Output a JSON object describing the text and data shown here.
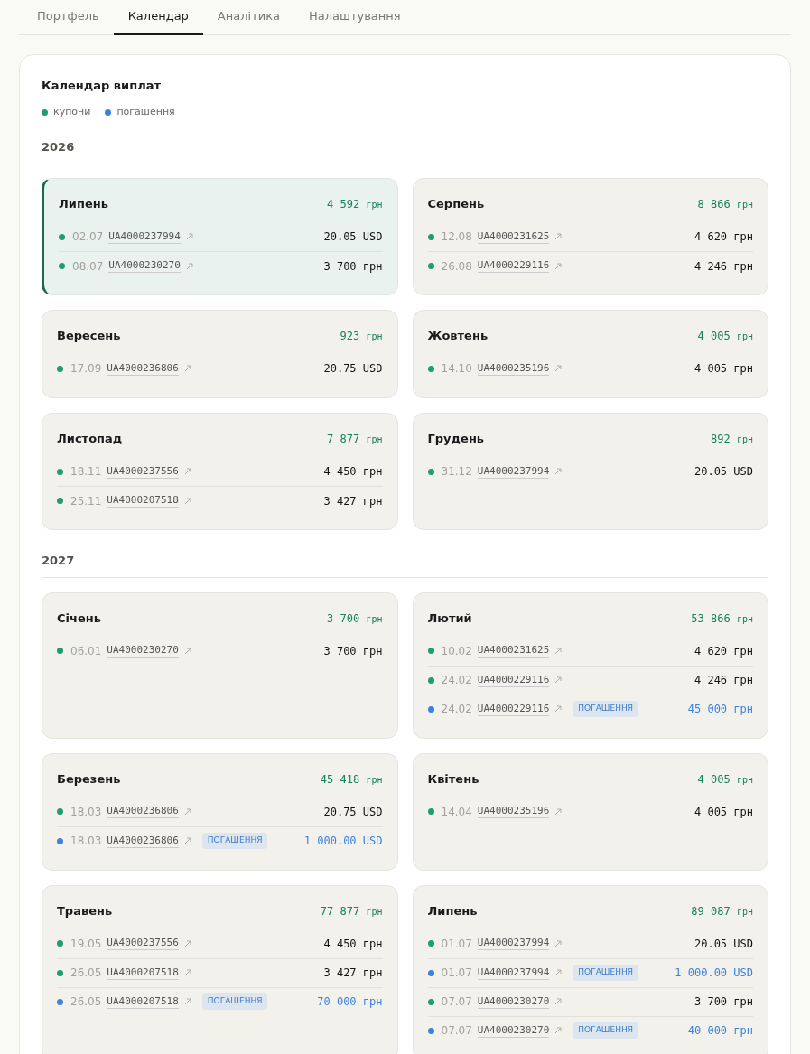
{
  "tabs": [
    {
      "label": "Портфель",
      "selected": false
    },
    {
      "label": "Календар",
      "selected": true
    },
    {
      "label": "Аналітика",
      "selected": false
    },
    {
      "label": "Налаштування",
      "selected": false
    }
  ],
  "panel": {
    "title": "Календар виплат",
    "legend": [
      {
        "label": "купони",
        "color": "#1f9d6e"
      },
      {
        "label": "погашення",
        "color": "#3b82e0"
      }
    ],
    "years": [
      {
        "year": "2026",
        "months": [
          {
            "name": "Липень",
            "total": "4 592",
            "unit": "грн",
            "current": true,
            "payments": [
              {
                "kind": "coupon",
                "date": "02.07",
                "isin": "UA4000237994",
                "amount": "20.05 USD"
              },
              {
                "kind": "coupon",
                "date": "08.07",
                "isin": "UA4000230270",
                "amount": "3 700 грн"
              }
            ]
          },
          {
            "name": "Серпень",
            "total": "8 866",
            "unit": "грн",
            "current": false,
            "payments": [
              {
                "kind": "coupon",
                "date": "12.08",
                "isin": "UA4000231625",
                "amount": "4 620 грн"
              },
              {
                "kind": "coupon",
                "date": "26.08",
                "isin": "UA4000229116",
                "amount": "4 246 грн"
              }
            ]
          },
          {
            "name": "Вересень",
            "total": "923",
            "unit": "грн",
            "current": false,
            "payments": [
              {
                "kind": "coupon",
                "date": "17.09",
                "isin": "UA4000236806",
                "amount": "20.75 USD"
              }
            ]
          },
          {
            "name": "Жовтень",
            "total": "4 005",
            "unit": "грн",
            "current": false,
            "payments": [
              {
                "kind": "coupon",
                "date": "14.10",
                "isin": "UA4000235196",
                "amount": "4 005 грн"
              }
            ]
          },
          {
            "name": "Листопад",
            "total": "7 877",
            "unit": "грн",
            "current": false,
            "payments": [
              {
                "kind": "coupon",
                "date": "18.11",
                "isin": "UA4000237556",
                "amount": "4 450 грн"
              },
              {
                "kind": "coupon",
                "date": "25.11",
                "isin": "UA4000207518",
                "amount": "3 427 грн"
              }
            ]
          },
          {
            "name": "Грудень",
            "total": "892",
            "unit": "грн",
            "current": false,
            "payments": [
              {
                "kind": "coupon",
                "date": "31.12",
                "isin": "UA4000237994",
                "amount": "20.05 USD"
              }
            ]
          }
        ]
      },
      {
        "year": "2027",
        "months": [
          {
            "name": "Січень",
            "total": "3 700",
            "unit": "грн",
            "current": false,
            "payments": [
              {
                "kind": "coupon",
                "date": "06.01",
                "isin": "UA4000230270",
                "amount": "3 700 грн"
              }
            ]
          },
          {
            "name": "Лютий",
            "total": "53 866",
            "unit": "грн",
            "current": false,
            "payments": [
              {
                "kind": "coupon",
                "date": "10.02",
                "isin": "UA4000231625",
                "amount": "4 620 грн"
              },
              {
                "kind": "coupon",
                "date": "24.02",
                "isin": "UA4000229116",
                "amount": "4 246 грн"
              },
              {
                "kind": "redemption",
                "date": "24.02",
                "isin": "UA4000229116",
                "badge": "ПОГАШЕННЯ",
                "amount": "45 000 грн"
              }
            ]
          },
          {
            "name": "Березень",
            "total": "45 418",
            "unit": "грн",
            "current": false,
            "payments": [
              {
                "kind": "coupon",
                "date": "18.03",
                "isin": "UA4000236806",
                "amount": "20.75 USD"
              },
              {
                "kind": "redemption",
                "date": "18.03",
                "isin": "UA4000236806",
                "badge": "ПОГАШЕННЯ",
                "amount": "1 000.00 USD"
              }
            ]
          },
          {
            "name": "Квітень",
            "total": "4 005",
            "unit": "грн",
            "current": false,
            "payments": [
              {
                "kind": "coupon",
                "date": "14.04",
                "isin": "UA4000235196",
                "amount": "4 005 грн"
              }
            ]
          },
          {
            "name": "Травень",
            "total": "77 877",
            "unit": "грн",
            "current": false,
            "payments": [
              {
                "kind": "coupon",
                "date": "19.05",
                "isin": "UA4000237556",
                "amount": "4 450 грн"
              },
              {
                "kind": "coupon",
                "date": "26.05",
                "isin": "UA4000207518",
                "amount": "3 427 грн"
              },
              {
                "kind": "redemption",
                "date": "26.05",
                "isin": "UA4000207518",
                "badge": "ПОГАШЕННЯ",
                "amount": "70 000 грн"
              }
            ]
          },
          {
            "name": "Липень",
            "total": "89 087",
            "unit": "грн",
            "current": false,
            "payments": [
              {
                "kind": "coupon",
                "date": "01.07",
                "isin": "UA4000237994",
                "amount": "20.05 USD"
              },
              {
                "kind": "redemption",
                "date": "01.07",
                "isin": "UA4000237994",
                "badge": "ПОГАШЕННЯ",
                "amount": "1 000.00 USD"
              },
              {
                "kind": "coupon",
                "date": "07.07",
                "isin": "UA4000230270",
                "amount": "3 700 грн"
              },
              {
                "kind": "redemption",
                "date": "07.07",
                "isin": "UA4000230270",
                "badge": "ПОГАШЕННЯ",
                "amount": "40 000 грн"
              }
            ]
          }
        ]
      }
    ]
  }
}
